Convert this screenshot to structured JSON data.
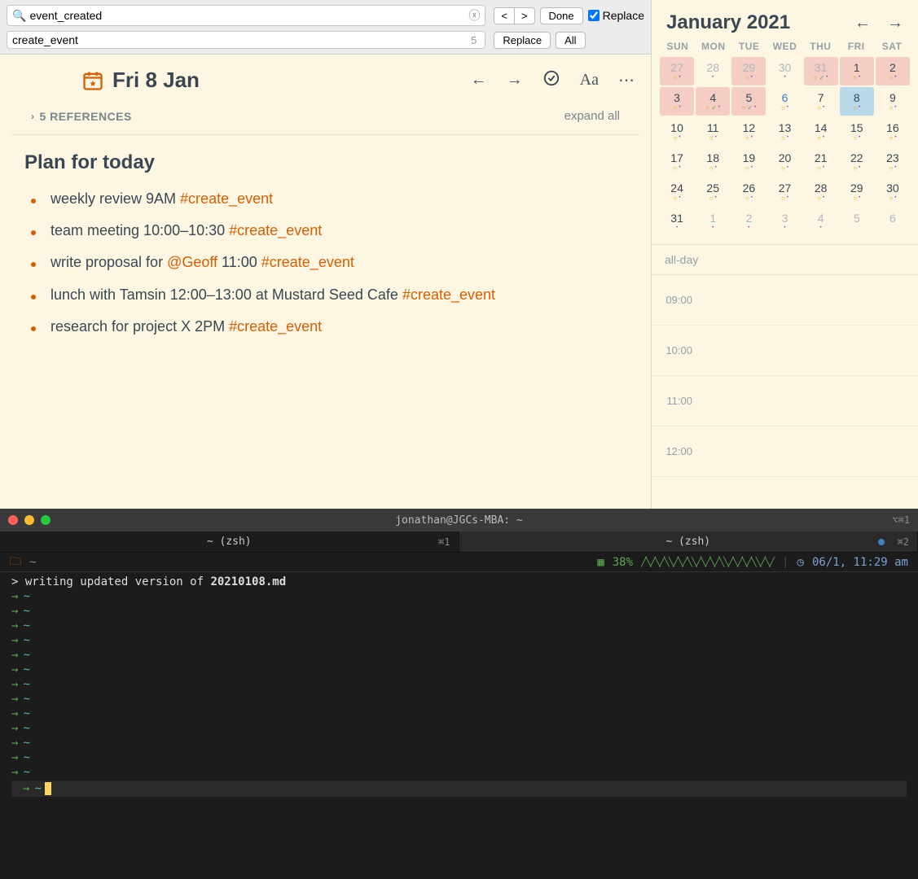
{
  "findbar": {
    "find_value": "event_created",
    "replace_value": "create_event",
    "match_count": "5",
    "done_label": "Done",
    "replace_checkbox_label": "Replace",
    "replace_btn_label": "Replace",
    "all_btn_label": "All",
    "prev_label": "<",
    "next_label": ">"
  },
  "note": {
    "title": "Fri 8 Jan",
    "references_label": "5 REFERENCES",
    "expand_all_label": "expand all",
    "heading": "Plan for today",
    "items": [
      {
        "pre": "weekly review 9AM ",
        "tag": "#create_event",
        "mention": "",
        "mid": "",
        "mention_pre": ""
      },
      {
        "pre": "team meeting 10:00–10:30 ",
        "tag": "#create_event",
        "mention": "",
        "mid": "",
        "mention_pre": ""
      },
      {
        "pre": "write proposal for ",
        "mention": "@Geoff",
        "mid": " 11:00 ",
        "tag": "#create_event",
        "mention_pre": ""
      },
      {
        "pre": "lunch with Tamsin 12:00–13:00 at Mustard Seed Cafe ",
        "tag": "#create_event",
        "mention": "",
        "mid": "",
        "mention_pre": ""
      },
      {
        "pre": "research for project X 2PM ",
        "tag": "#create_event",
        "mention": "",
        "mid": "",
        "mention_pre": ""
      }
    ]
  },
  "calendar": {
    "title": "January 2021",
    "dow": [
      "SUN",
      "MON",
      "TUE",
      "WED",
      "THU",
      "FRI",
      "SAT"
    ],
    "cells": [
      {
        "n": "27",
        "cls": "hl other-month",
        "dots": "o."
      },
      {
        "n": "28",
        "cls": "other-month",
        "dots": "."
      },
      {
        "n": "29",
        "cls": "hl other-month",
        "dots": "o."
      },
      {
        "n": "30",
        "cls": "other-month",
        "dots": "."
      },
      {
        "n": "31",
        "cls": "hl other-month",
        "dots": "ov."
      },
      {
        "n": "1",
        "cls": "hl",
        "dots": "o."
      },
      {
        "n": "2",
        "cls": "hl",
        "dots": "o."
      },
      {
        "n": "3",
        "cls": "hl",
        "dots": "o."
      },
      {
        "n": "4",
        "cls": "hl",
        "dots": "ov."
      },
      {
        "n": "5",
        "cls": "hl",
        "dots": "ov."
      },
      {
        "n": "6",
        "cls": "blue-day",
        "dots": "o."
      },
      {
        "n": "7",
        "cls": "",
        "dots": "o."
      },
      {
        "n": "8",
        "cls": "selected",
        "dots": "o."
      },
      {
        "n": "9",
        "cls": "",
        "dots": "o."
      },
      {
        "n": "10",
        "cls": "",
        "dots": "o."
      },
      {
        "n": "11",
        "cls": "",
        "dots": "o."
      },
      {
        "n": "12",
        "cls": "",
        "dots": "o."
      },
      {
        "n": "13",
        "cls": "",
        "dots": "o."
      },
      {
        "n": "14",
        "cls": "",
        "dots": "o."
      },
      {
        "n": "15",
        "cls": "",
        "dots": "o."
      },
      {
        "n": "16",
        "cls": "",
        "dots": "o."
      },
      {
        "n": "17",
        "cls": "",
        "dots": "o."
      },
      {
        "n": "18",
        "cls": "",
        "dots": "o."
      },
      {
        "n": "19",
        "cls": "",
        "dots": "o."
      },
      {
        "n": "20",
        "cls": "",
        "dots": "o."
      },
      {
        "n": "21",
        "cls": "",
        "dots": "o."
      },
      {
        "n": "22",
        "cls": "",
        "dots": "o."
      },
      {
        "n": "23",
        "cls": "",
        "dots": "o."
      },
      {
        "n": "24",
        "cls": "",
        "dots": "o."
      },
      {
        "n": "25",
        "cls": "",
        "dots": "o."
      },
      {
        "n": "26",
        "cls": "",
        "dots": "o."
      },
      {
        "n": "27",
        "cls": "",
        "dots": "o."
      },
      {
        "n": "28",
        "cls": "",
        "dots": "o."
      },
      {
        "n": "29",
        "cls": "",
        "dots": "o."
      },
      {
        "n": "30",
        "cls": "",
        "dots": "o."
      },
      {
        "n": "31",
        "cls": "",
        "dots": "."
      },
      {
        "n": "1",
        "cls": "other-month",
        "dots": "."
      },
      {
        "n": "2",
        "cls": "other-month",
        "dots": "."
      },
      {
        "n": "3",
        "cls": "other-month",
        "dots": "."
      },
      {
        "n": "4",
        "cls": "other-month",
        "dots": "."
      },
      {
        "n": "5",
        "cls": "other-month",
        "dots": ""
      },
      {
        "n": "6",
        "cls": "other-month",
        "dots": ""
      }
    ],
    "allday_label": "all-day",
    "hours": [
      "09:00",
      "10:00",
      "11:00",
      "12:00"
    ]
  },
  "terminal": {
    "title": "jonathan@JGCs-MBA: ~",
    "tabs": [
      {
        "label": "~ (zsh)",
        "shortcut": "⌘1",
        "active": true,
        "dot": false
      },
      {
        "label": "~ (zsh)",
        "shortcut": "⌘2",
        "active": false,
        "dot": true
      }
    ],
    "status": {
      "path": "~",
      "cpu_pct": "38%",
      "datetime": "06/1, 11:29 am"
    },
    "output_prefix": "> ",
    "output_text": "writing updated version of ",
    "output_filename": "20210108.md",
    "empty_line_count": 13
  }
}
